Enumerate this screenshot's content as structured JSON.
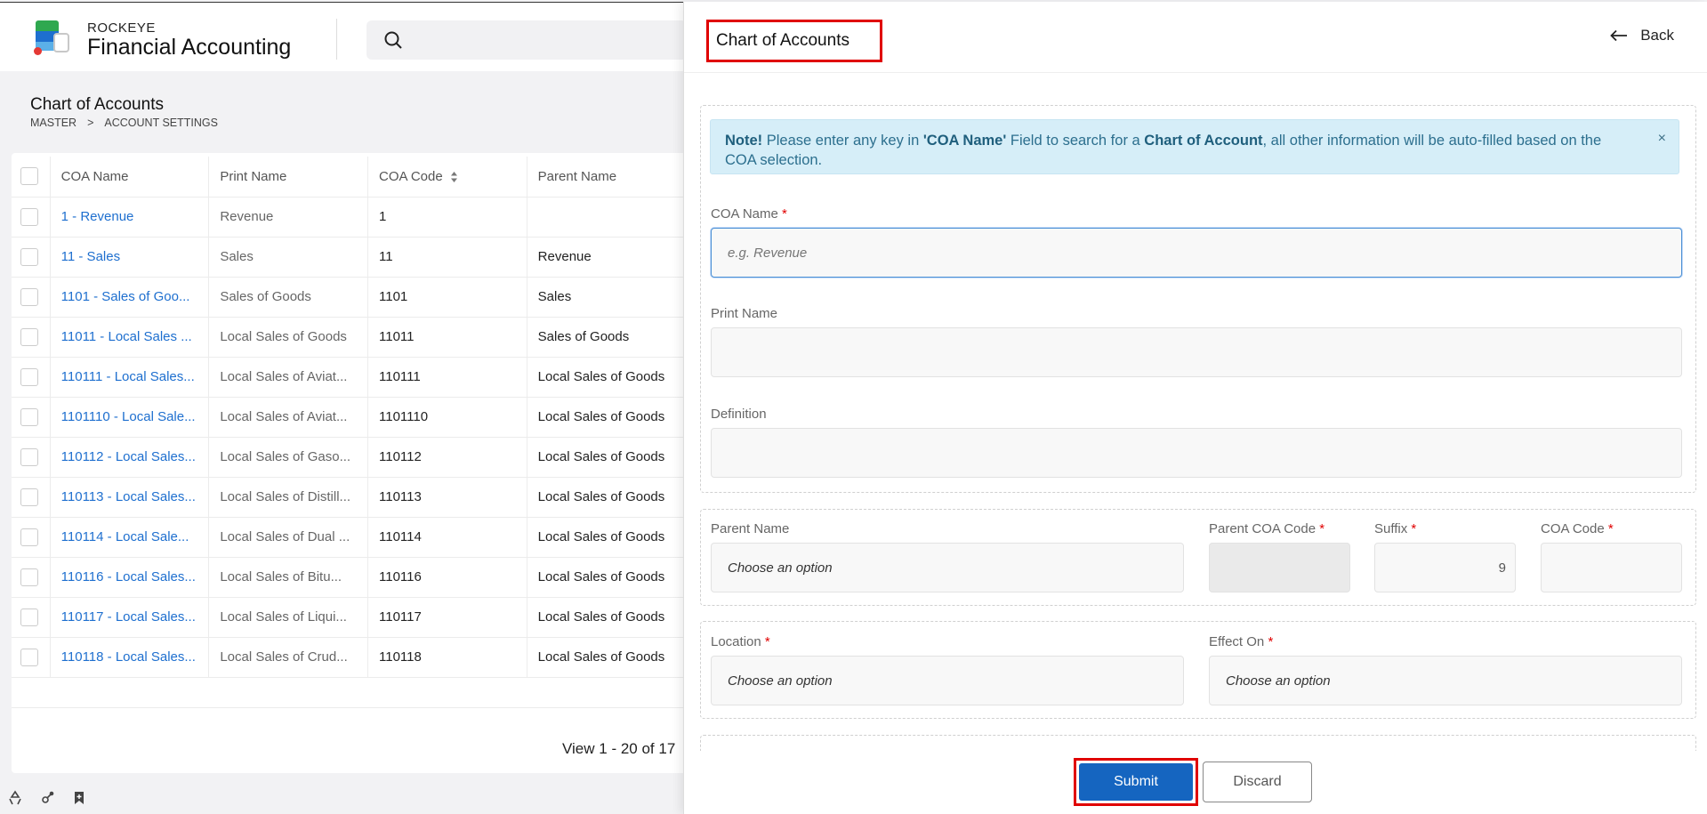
{
  "header": {
    "brand_small": "ROCKEYE",
    "brand_big": "Financial Accounting",
    "search_placeholder": ""
  },
  "page": {
    "title": "Chart of Accounts",
    "breadcrumb": [
      "MASTER",
      ">",
      "ACCOUNT SETTINGS"
    ]
  },
  "table": {
    "columns": [
      "COA Name",
      "Print Name",
      "COA Code",
      "Parent Name"
    ],
    "rows": [
      {
        "name": "1 - Revenue",
        "print": "Revenue",
        "code": "1",
        "parent": ""
      },
      {
        "name": "11 - Sales",
        "print": "Sales",
        "code": "11",
        "parent": "Revenue"
      },
      {
        "name": "1101 - Sales of Goo...",
        "print": "Sales of Goods",
        "code": "1101",
        "parent": "Sales"
      },
      {
        "name": "11011 - Local Sales ...",
        "print": "Local Sales of Goods",
        "code": "11011",
        "parent": "Sales of Goods"
      },
      {
        "name": "110111 - Local Sales...",
        "print": "Local Sales of Aviat...",
        "code": "110111",
        "parent": "Local Sales of Goods"
      },
      {
        "name": "1101110 - Local Sale...",
        "print": "Local Sales of Aviat...",
        "code": "1101110",
        "parent": "Local Sales of Goods"
      },
      {
        "name": "110112 - Local Sales...",
        "print": "Local Sales of Gaso...",
        "code": "110112",
        "parent": "Local Sales of Goods"
      },
      {
        "name": "110113 - Local Sales...",
        "print": "Local Sales of Distill...",
        "code": "110113",
        "parent": "Local Sales of Goods"
      },
      {
        "name": "110114 - Local Sale...",
        "print": "Local Sales of Dual ...",
        "code": "110114",
        "parent": "Local Sales of Goods"
      },
      {
        "name": "110116 - Local Sales...",
        "print": "Local Sales of Bitu...",
        "code": "110116",
        "parent": "Local Sales of Goods"
      },
      {
        "name": "110117 - Local Sales...",
        "print": "Local Sales of Liqui...",
        "code": "110117",
        "parent": "Local Sales of Goods"
      },
      {
        "name": "110118 - Local Sales...",
        "print": "Local Sales of Crud...",
        "code": "110118",
        "parent": "Local Sales of Goods"
      }
    ],
    "pager": "View 1 - 20 of 17"
  },
  "panel": {
    "title": "Chart of Accounts",
    "back_label": "Back",
    "note": {
      "prefix": "Note!",
      "text1": " Please enter any key in ",
      "field": "'COA Name'",
      "text2": " Field to search for a ",
      "entity": "Chart of Account",
      "text3": ", all other information will be auto-filled based on the COA selection.",
      "close": "×"
    },
    "fields": {
      "coa_name_label": "COA Name",
      "coa_name_placeholder": "e.g. Revenue",
      "print_name_label": "Print Name",
      "definition_label": "Definition",
      "parent_name_label": "Parent Name",
      "parent_name_value": "Choose an option",
      "parent_coa_code_label": "Parent COA Code",
      "suffix_label": "Suffix",
      "suffix_value": "9",
      "coa_code_label": "COA Code",
      "location_label": "Location",
      "location_value": "Choose an option",
      "effect_on_label": "Effect On",
      "effect_on_value": "Choose an option",
      "required_mark": "*"
    },
    "submit_label": "Submit",
    "discard_label": "Discard"
  },
  "colors": {
    "accent": "#1565c0",
    "link": "#1e6fcf",
    "highlight": "#e00000",
    "note_bg": "#d6eef8"
  }
}
